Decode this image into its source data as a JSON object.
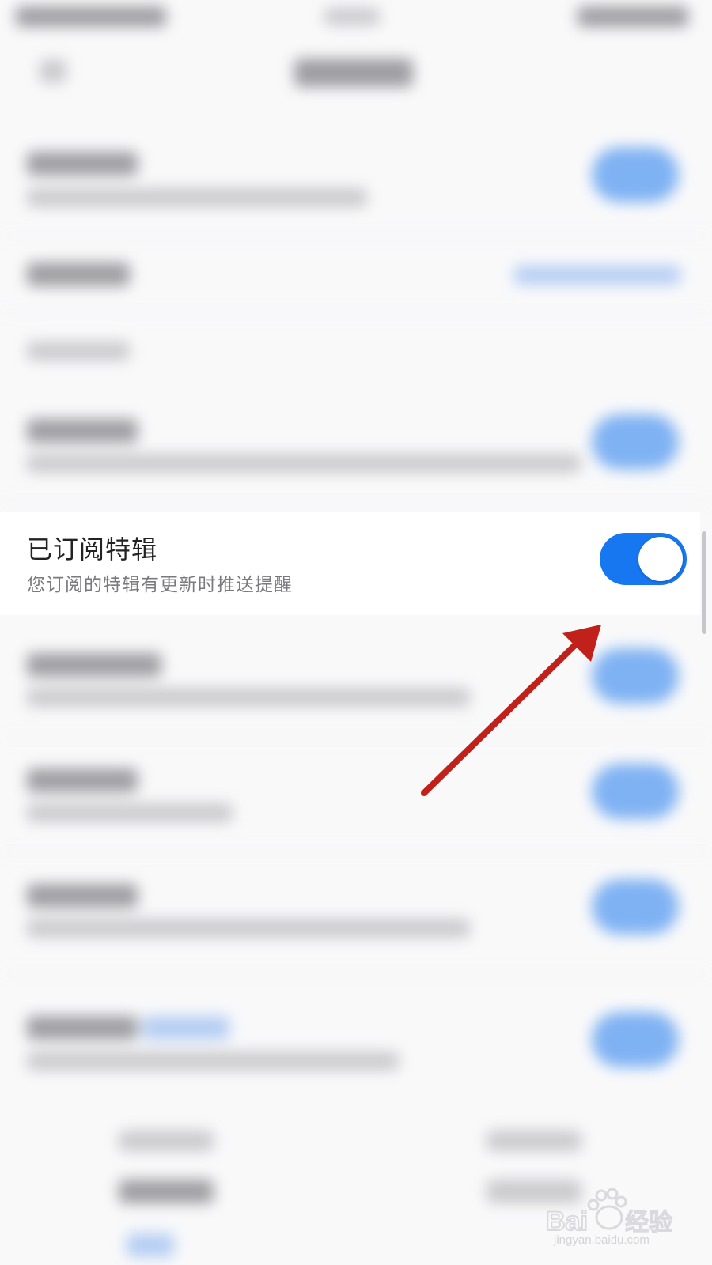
{
  "setting_row": {
    "title": "已订阅特辑",
    "subtitle": "您订阅的特辑有更新时推送提醒",
    "toggle_on": true
  },
  "watermark": {
    "brand": "Bai经验",
    "url": "jingyan.baidu.com"
  },
  "colors": {
    "toggle_on": "#1677f0",
    "annotation_arrow": "#c0211b"
  }
}
